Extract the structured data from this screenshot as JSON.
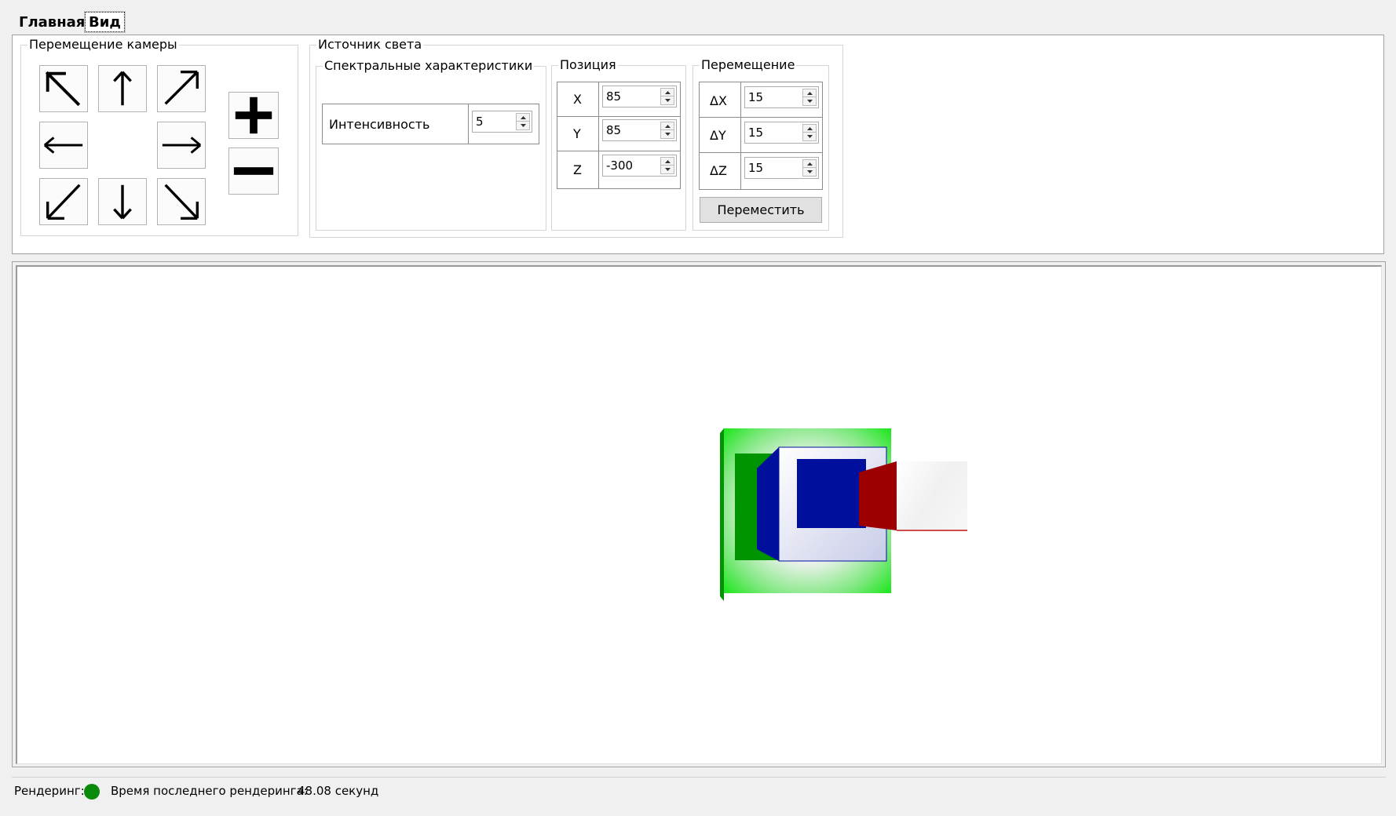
{
  "tabs": [
    {
      "label": "Главная",
      "active": false
    },
    {
      "label": "Вид",
      "active": true
    }
  ],
  "camera_group": {
    "title": "Перемещение камеры",
    "buttons": [
      "arrow-up-left-icon",
      "arrow-up-icon",
      "arrow-up-right-icon",
      "arrow-left-icon",
      "arrow-right-icon",
      "arrow-down-left-icon",
      "arrow-down-icon",
      "arrow-down-right-icon",
      "zoom-in-icon",
      "zoom-out-icon"
    ]
  },
  "light_group": {
    "title": "Источник света",
    "spectral": {
      "title": "Спектральные характеристики",
      "intensity_label": "Интенсивность",
      "intensity_value": "5"
    },
    "position": {
      "title": "Позиция",
      "x_label": "X",
      "x_value": "85",
      "y_label": "Y",
      "y_value": "85",
      "z_label": "Z",
      "z_value": "-300"
    },
    "move": {
      "title": "Перемещение",
      "dx_label": "ΔX",
      "dx_value": "15",
      "dy_label": "ΔY",
      "dy_value": "15",
      "dz_label": "ΔZ",
      "dz_value": "15",
      "button_label": "Переместить"
    }
  },
  "status": {
    "render_label": "Рендеринг:",
    "render_indicator_color": "#0a8a0a",
    "last_render_label": "Время последнего рендеринга:",
    "last_render_value": "48.08 секунд"
  },
  "colors": {
    "green": "#12e612",
    "dark_green": "#009400",
    "blue": "#000f9c",
    "red": "#9c0000"
  }
}
